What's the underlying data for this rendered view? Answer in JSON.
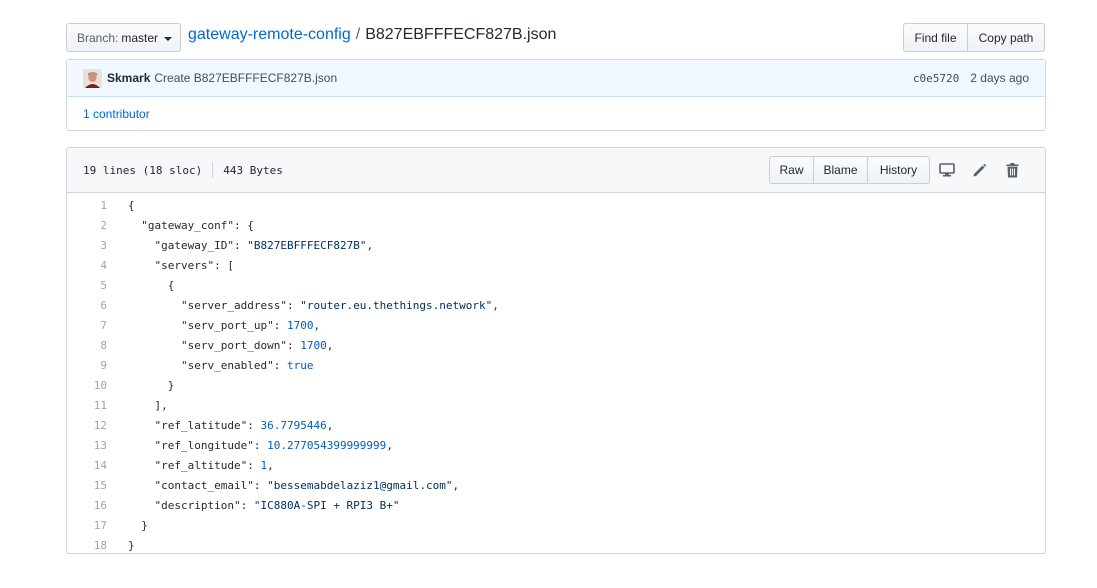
{
  "branch": {
    "label": "Branch:",
    "value": "master"
  },
  "breadcrumb": {
    "repo": "gateway-remote-config",
    "separator": "/",
    "file": "B827EBFFFECF827B.json"
  },
  "top_buttons": {
    "find_file": "Find file",
    "copy_path": "Copy path"
  },
  "commit": {
    "author": "Skmark",
    "message": "Create B827EBFFFECF827B.json",
    "sha": "c0e5720",
    "age": "2 days ago",
    "contributors": "1 contributor"
  },
  "file": {
    "lines_info": "19 lines (18 sloc)",
    "size": "443 Bytes",
    "buttons": {
      "raw": "Raw",
      "blame": "Blame",
      "history": "History"
    },
    "icons": [
      "desktop-icon",
      "pencil-icon",
      "trash-icon"
    ]
  },
  "code_lines": [
    {
      "n": "1",
      "parts": [
        [
          "p",
          "{"
        ]
      ]
    },
    {
      "n": "2",
      "parts": [
        [
          "p",
          "  "
        ],
        [
          "k",
          "\"gateway_conf\""
        ],
        [
          "p",
          ": {"
        ]
      ]
    },
    {
      "n": "3",
      "parts": [
        [
          "p",
          "    "
        ],
        [
          "k",
          "\"gateway_ID\""
        ],
        [
          "p",
          ": "
        ],
        [
          "s",
          "\"B827EBFFFECF827B\""
        ],
        [
          "p",
          ","
        ]
      ]
    },
    {
      "n": "4",
      "parts": [
        [
          "p",
          "    "
        ],
        [
          "k",
          "\"servers\""
        ],
        [
          "p",
          ": ["
        ]
      ]
    },
    {
      "n": "5",
      "parts": [
        [
          "p",
          "      {"
        ]
      ]
    },
    {
      "n": "6",
      "parts": [
        [
          "p",
          "        "
        ],
        [
          "k",
          "\"server_address\""
        ],
        [
          "p",
          ": "
        ],
        [
          "s",
          "\"router.eu.thethings.network\""
        ],
        [
          "p",
          ","
        ]
      ]
    },
    {
      "n": "7",
      "parts": [
        [
          "p",
          "        "
        ],
        [
          "k",
          "\"serv_port_up\""
        ],
        [
          "p",
          ": "
        ],
        [
          "n",
          "1700"
        ],
        [
          "p",
          ","
        ]
      ]
    },
    {
      "n": "8",
      "parts": [
        [
          "p",
          "        "
        ],
        [
          "k",
          "\"serv_port_down\""
        ],
        [
          "p",
          ": "
        ],
        [
          "n",
          "1700"
        ],
        [
          "p",
          ","
        ]
      ]
    },
    {
      "n": "9",
      "parts": [
        [
          "p",
          "        "
        ],
        [
          "k",
          "\"serv_enabled\""
        ],
        [
          "p",
          ": "
        ],
        [
          "n",
          "true"
        ]
      ]
    },
    {
      "n": "10",
      "parts": [
        [
          "p",
          "      }"
        ]
      ]
    },
    {
      "n": "11",
      "parts": [
        [
          "p",
          "    ],"
        ]
      ]
    },
    {
      "n": "12",
      "parts": [
        [
          "p",
          "    "
        ],
        [
          "k",
          "\"ref_latitude\""
        ],
        [
          "p",
          ": "
        ],
        [
          "n",
          "36.7795446"
        ],
        [
          "p",
          ","
        ]
      ]
    },
    {
      "n": "13",
      "parts": [
        [
          "p",
          "    "
        ],
        [
          "k",
          "\"ref_longitude\""
        ],
        [
          "p",
          ": "
        ],
        [
          "n",
          "10.277054399999999"
        ],
        [
          "p",
          ","
        ]
      ]
    },
    {
      "n": "14",
      "parts": [
        [
          "p",
          "    "
        ],
        [
          "k",
          "\"ref_altitude\""
        ],
        [
          "p",
          ": "
        ],
        [
          "n",
          "1"
        ],
        [
          "p",
          ","
        ]
      ]
    },
    {
      "n": "15",
      "parts": [
        [
          "p",
          "    "
        ],
        [
          "k",
          "\"contact_email\""
        ],
        [
          "p",
          ": "
        ],
        [
          "s",
          "\"bessemabdelaziz1@gmail.com\""
        ],
        [
          "p",
          ","
        ]
      ]
    },
    {
      "n": "16",
      "parts": [
        [
          "p",
          "    "
        ],
        [
          "k",
          "\"description\""
        ],
        [
          "p",
          ": "
        ],
        [
          "s",
          "\"IC880A-SPI + RPI3 B+\""
        ]
      ]
    },
    {
      "n": "17",
      "parts": [
        [
          "p",
          "  }"
        ]
      ]
    },
    {
      "n": "18",
      "parts": [
        [
          "p",
          "}"
        ]
      ]
    }
  ],
  "colors": {
    "link": "#0366d6",
    "string": "#032f62",
    "number": "#005cc5",
    "commit_bg": "#f1f8ff"
  }
}
